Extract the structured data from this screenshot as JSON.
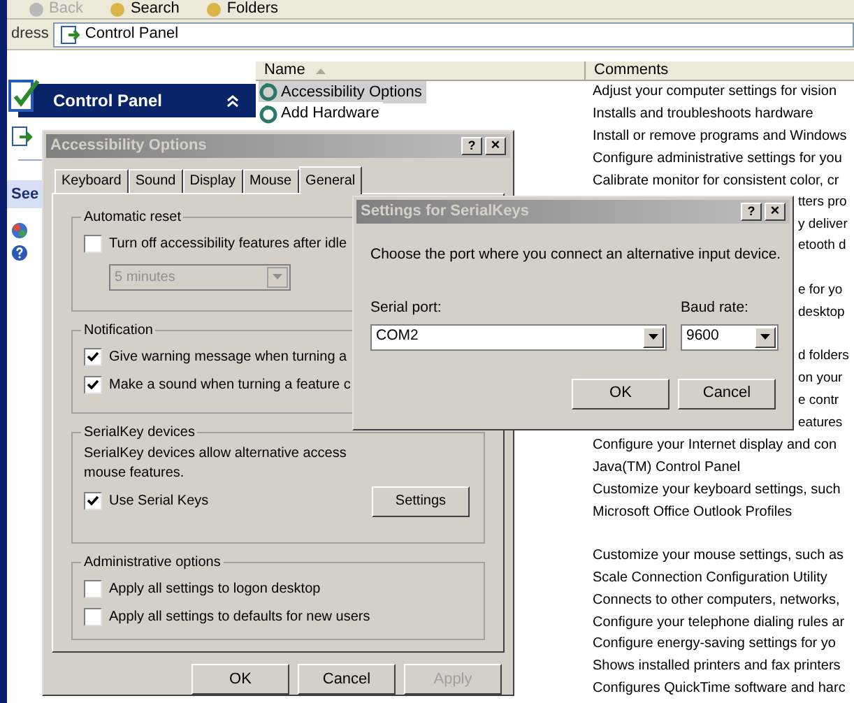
{
  "toolbar": {
    "buttons": [
      {
        "label": "Back",
        "disabled": true
      },
      {
        "label": "Search",
        "disabled": false
      },
      {
        "label": "Folders",
        "disabled": false
      }
    ]
  },
  "address_bar": {
    "label": "dress",
    "value": "Control Panel"
  },
  "task_pane": {
    "title": "Control Panel",
    "section_title": "See"
  },
  "list": {
    "columns": [
      "Name",
      "Comments"
    ],
    "rows": [
      {
        "name": "Accessibility Options",
        "comment": "Adjust your computer settings for vision",
        "selected": true,
        "kind": "full"
      },
      {
        "name": "Add Hardware",
        "comment": "Installs and troubleshoots hardware",
        "selected": false,
        "kind": "full"
      },
      {
        "comment": "Install or remove programs and Windows",
        "selected": false,
        "kind": "full"
      },
      {
        "comment": "Configure administrative settings for you",
        "selected": false,
        "kind": "full"
      },
      {
        "comment": "Calibrate monitor for consistent color, cr",
        "selected": false,
        "kind": "full"
      },
      {
        "comment": "tters pro",
        "selected": false,
        "kind": "partial"
      },
      {
        "comment": "y deliver",
        "selected": false,
        "kind": "partial"
      },
      {
        "comment": "etooth d",
        "selected": false,
        "kind": "partial"
      },
      {
        "selected": false,
        "kind": "full"
      },
      {
        "comment": "e for yo",
        "selected": false,
        "kind": "partial"
      },
      {
        "comment": "desktop",
        "selected": false,
        "kind": "partial"
      },
      {
        "selected": false,
        "kind": "full"
      },
      {
        "comment": "d folders",
        "selected": false,
        "kind": "partial"
      },
      {
        "comment": "on your",
        "selected": false,
        "kind": "partial"
      },
      {
        "comment": "e contr",
        "selected": false,
        "kind": "partial"
      },
      {
        "comment": "eatures",
        "selected": false,
        "kind": "partial"
      },
      {
        "comment": "Configure your Internet display and con",
        "selected": false,
        "kind": "full"
      },
      {
        "comment": "Java(TM) Control Panel",
        "selected": false,
        "kind": "full"
      },
      {
        "comment": "Customize your keyboard settings, such",
        "selected": false,
        "kind": "full"
      },
      {
        "comment": "Microsoft Office Outlook Profiles",
        "selected": false,
        "kind": "full"
      },
      {
        "selected": false,
        "kind": "full"
      },
      {
        "comment": "Customize your mouse settings, such as",
        "selected": false,
        "kind": "full"
      },
      {
        "comment": "Scale Connection Configuration Utility",
        "selected": false,
        "kind": "full"
      },
      {
        "comment": "Connects to other computers, networks,",
        "selected": false,
        "kind": "full"
      },
      {
        "comment": "Configure your telephone dialing rules ar",
        "selected": false,
        "kind": "full"
      },
      {
        "comment": "Configure energy-saving settings for yo",
        "selected": false,
        "kind": "full"
      },
      {
        "comment": "Shows installed printers and fax printers",
        "selected": false,
        "kind": "full"
      },
      {
        "comment": "Configures QuickTime software and harc",
        "selected": false,
        "kind": "full"
      }
    ]
  },
  "accessibility_dialog": {
    "title": "Accessibility Options",
    "help": "?",
    "close": "×",
    "tabs": [
      {
        "label": "Keyboard",
        "selected": false
      },
      {
        "label": "Sound",
        "selected": false
      },
      {
        "label": "Display",
        "selected": false
      },
      {
        "label": "Mouse",
        "selected": false
      },
      {
        "label": "General",
        "selected": true
      }
    ],
    "automatic_reset": {
      "title": "Automatic reset",
      "checkbox": {
        "label": "Turn off accessibility features after idle",
        "checked": false
      },
      "select": {
        "value": "5 minutes",
        "disabled": true
      }
    },
    "notification": {
      "title": "Notification",
      "checkboxes": [
        {
          "label": "Give warning message when turning a",
          "checked": true
        },
        {
          "label": "Make a sound when turning a feature c",
          "checked": true
        }
      ]
    },
    "serialkey_devices": {
      "title": "SerialKey devices",
      "description": "SerialKey devices allow alternative access",
      "description_2": "mouse features.",
      "checkbox": {
        "label": "Use Serial Keys",
        "checked": true
      },
      "button": "Settings"
    },
    "administrative_options": {
      "title": "Administrative options",
      "checkboxes": [
        {
          "label": "Apply all settings to logon desktop",
          "checked": false
        },
        {
          "label": "Apply all settings to defaults for new users",
          "checked": false
        }
      ]
    },
    "buttons": [
      {
        "label": "OK",
        "disabled": false
      },
      {
        "label": "Cancel",
        "disabled": false
      },
      {
        "label": "Apply",
        "disabled": true
      }
    ]
  },
  "serialkeys_dialog": {
    "title": "Settings for SerialKeys",
    "help": "?",
    "close": "×",
    "instruction": "Choose the port where you connect an alternative input device.",
    "serial_port": {
      "label": "Serial port:",
      "value": "COM2"
    },
    "baud_rate": {
      "label": "Baud rate:",
      "value": "9600"
    },
    "buttons": [
      {
        "label": "OK",
        "disabled": false
      },
      {
        "label": "Cancel",
        "disabled": false
      }
    ]
  }
}
